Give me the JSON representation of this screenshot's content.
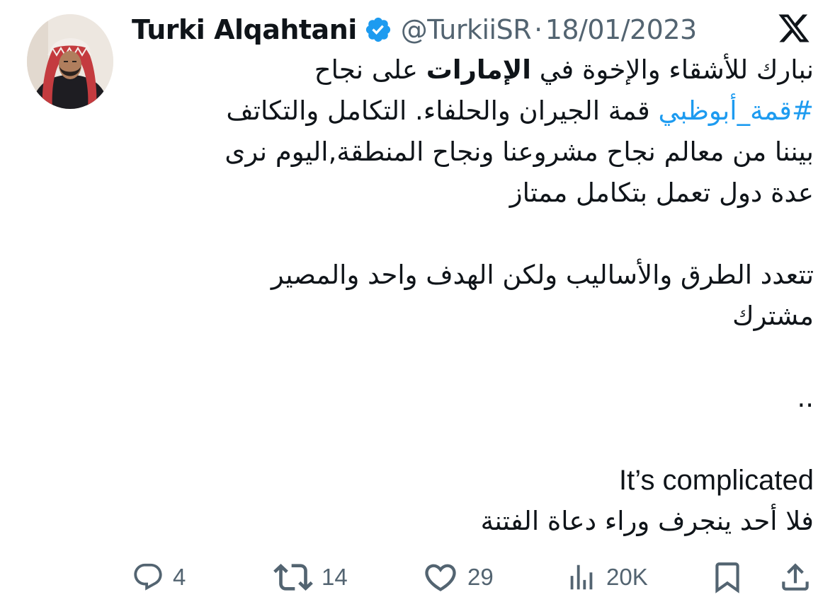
{
  "author": {
    "display_name": "Turki Alqahtani",
    "handle": "@TurkiiSR",
    "separator": "·",
    "date": "18/01/2023",
    "verified": true,
    "avatar_icon": "avatar-photo"
  },
  "brand": {
    "logo_icon": "x-logo-icon"
  },
  "tweet": {
    "line1_pre": "نبارك للأشقاء والإخوة في ",
    "line1_bold": "الإمارات",
    "line1_post": " على نجاح",
    "hashtag": "#قمة_أبوظبي",
    "line2_post": " قمة الجيران والحلفاء. التكامل والتكاتف",
    "line3": "بيننا من معالم نجاح مشروعنا ونجاح المنطقة,اليوم نرى",
    "line4": "عدة دول تعمل بتكامل ممتاز",
    "line5": "تتعدد الطرق والأساليب ولكن الهدف واحد والمصير",
    "line6": "مشترك",
    "line7": "..",
    "line8": "It’s complicated",
    "line9": "فلا أحد ينجرف وراء دعاة الفتنة"
  },
  "actions": {
    "replies": "4",
    "reposts": "14",
    "likes": "29",
    "views": "20K"
  },
  "colors": {
    "text": "#0f1419",
    "secondary": "#536471",
    "link": "#1d9bf0",
    "verified": "#1d9bf0"
  }
}
